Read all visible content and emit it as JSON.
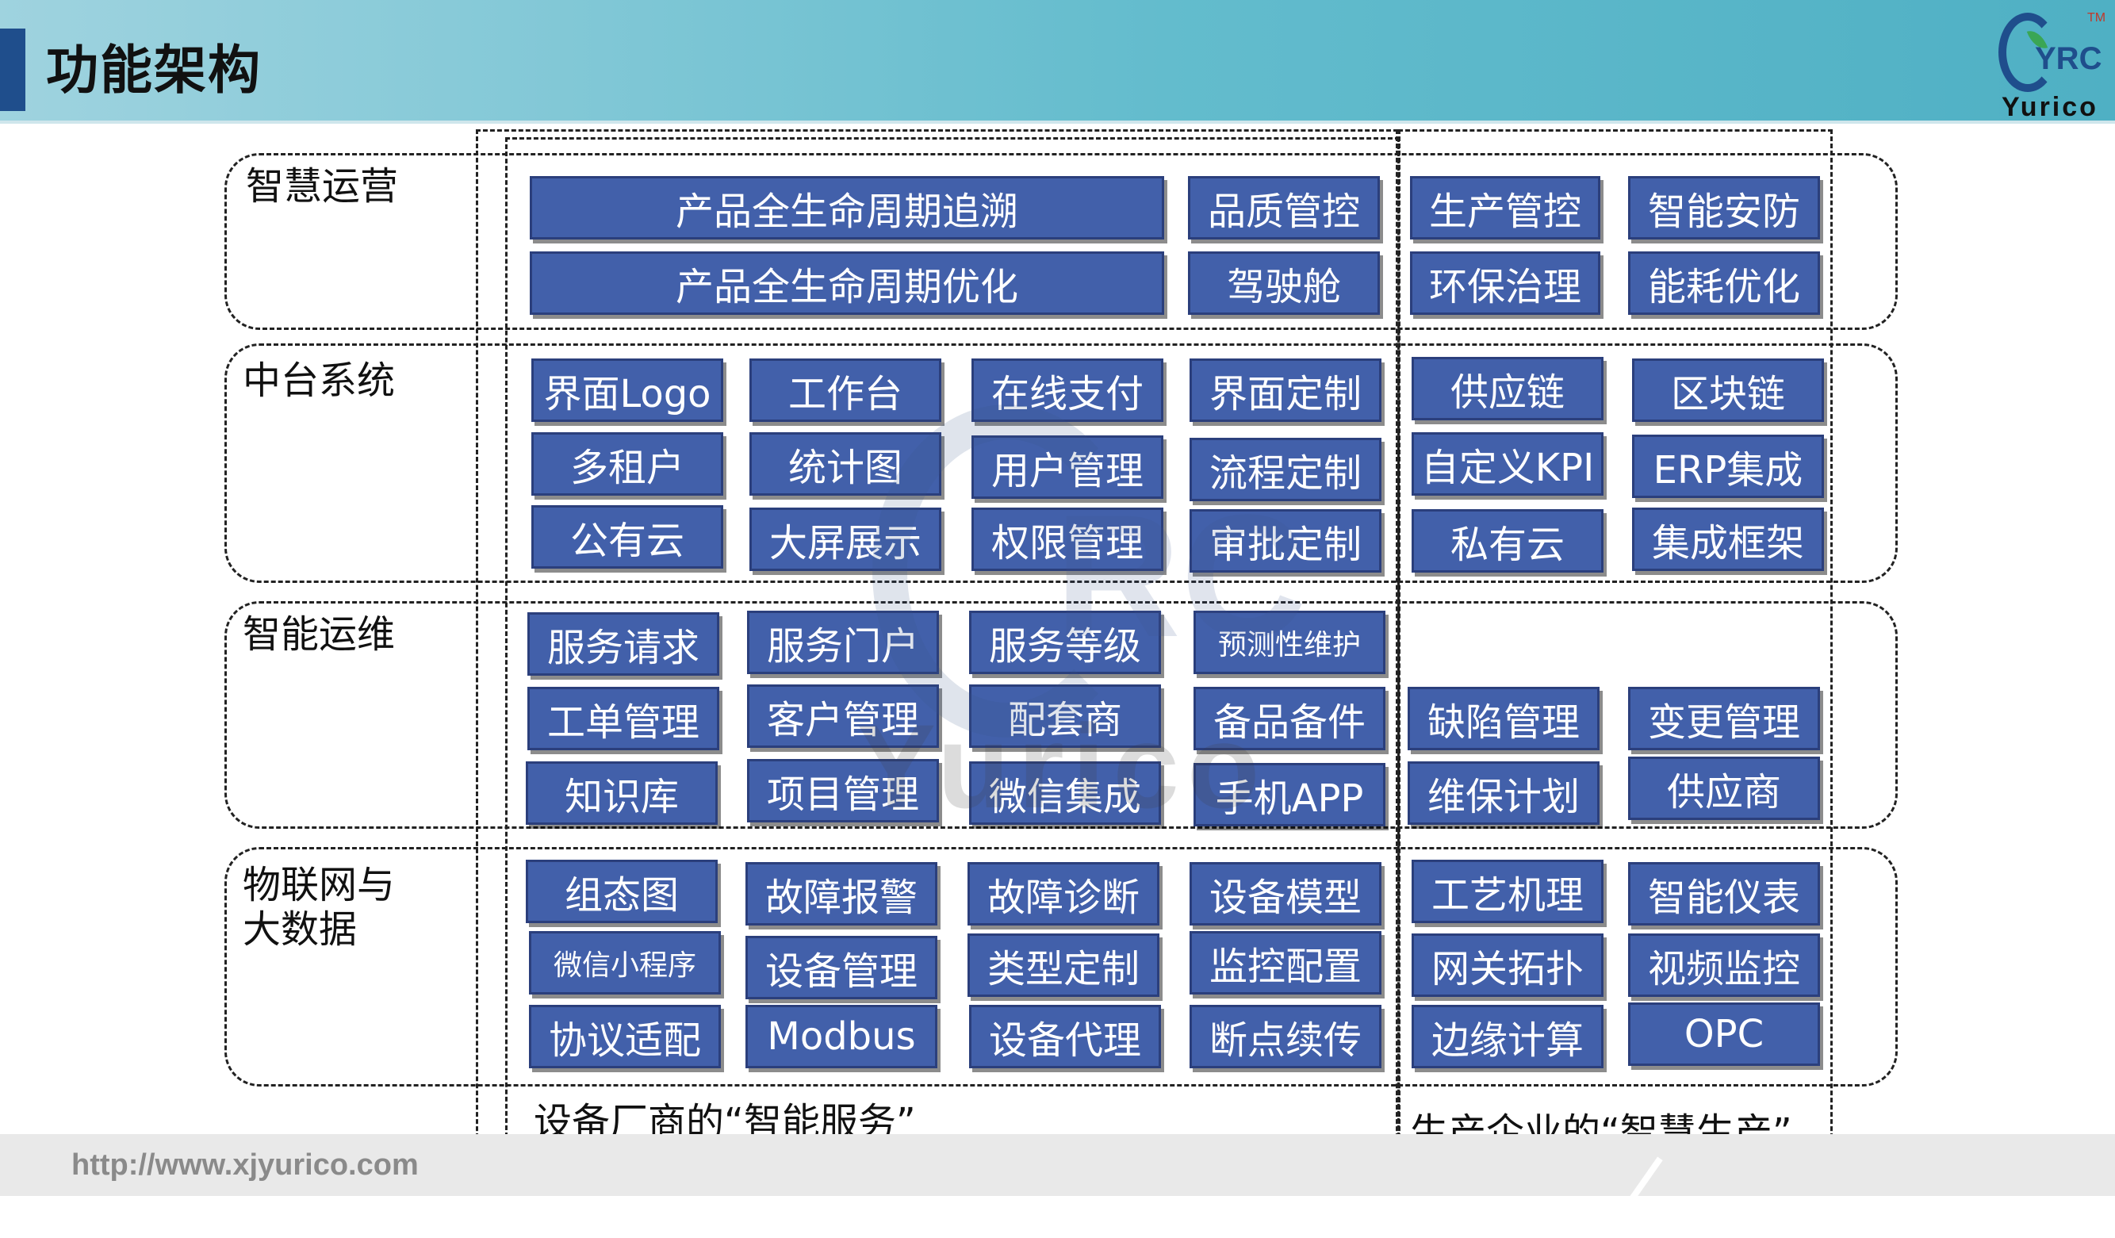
{
  "header": {
    "title": "功能架构",
    "logo_text": "YRC",
    "logo_name": "Yurico",
    "logo_tm": "TM"
  },
  "rows": [
    {
      "label": "智慧运营",
      "service": [
        "产品全生命周期追溯",
        "品质管控",
        "产品全生命周期优化",
        "驾驶舱"
      ],
      "production": [
        "生产管控",
        "智能安防",
        "环保治理",
        "能耗优化"
      ]
    },
    {
      "label": "中台系统",
      "service": [
        "界面Logo",
        "工作台",
        "在线支付",
        "界面定制",
        "多租户",
        "统计图",
        "用户管理",
        "流程定制",
        "公有云",
        "大屏展示",
        "权限管理",
        "审批定制"
      ],
      "production": [
        "供应链",
        "区块链",
        "自定义KPI",
        "ERP集成",
        "私有云",
        "集成框架"
      ]
    },
    {
      "label": "智能运维",
      "service": [
        "服务请求",
        "服务门户",
        "服务等级",
        "预测性维护",
        "工单管理",
        "客户管理",
        "配套商",
        "备品备件",
        "知识库",
        "项目管理",
        "微信集成",
        "手机APP"
      ],
      "production": [
        "缺陷管理",
        "变更管理",
        "维保计划",
        "供应商"
      ]
    },
    {
      "label": "物联网与大数据",
      "service": [
        "组态图",
        "故障报警",
        "故障诊断",
        "设备模型",
        "微信小程序",
        "设备管理",
        "类型定制",
        "监控配置",
        "协议适配",
        "Modbus",
        "设备代理",
        "断点续传"
      ],
      "production": [
        "工艺机理",
        "智能仪表",
        "网关拓扑",
        "视频监控",
        "边缘计算",
        "OPC"
      ]
    }
  ],
  "bottom": {
    "service_caption": "设备厂商的“智能服务”",
    "production_caption": "生产企业的“智慧生产”"
  },
  "footer": {
    "url": "http://www.xjyurico.com"
  },
  "watermark": {
    "text": "Yurico",
    "mark": "RC"
  },
  "colors": {
    "box_fill": "#4260aa",
    "box_border": "#2b3f7c",
    "accent": "#1f4e8c"
  }
}
